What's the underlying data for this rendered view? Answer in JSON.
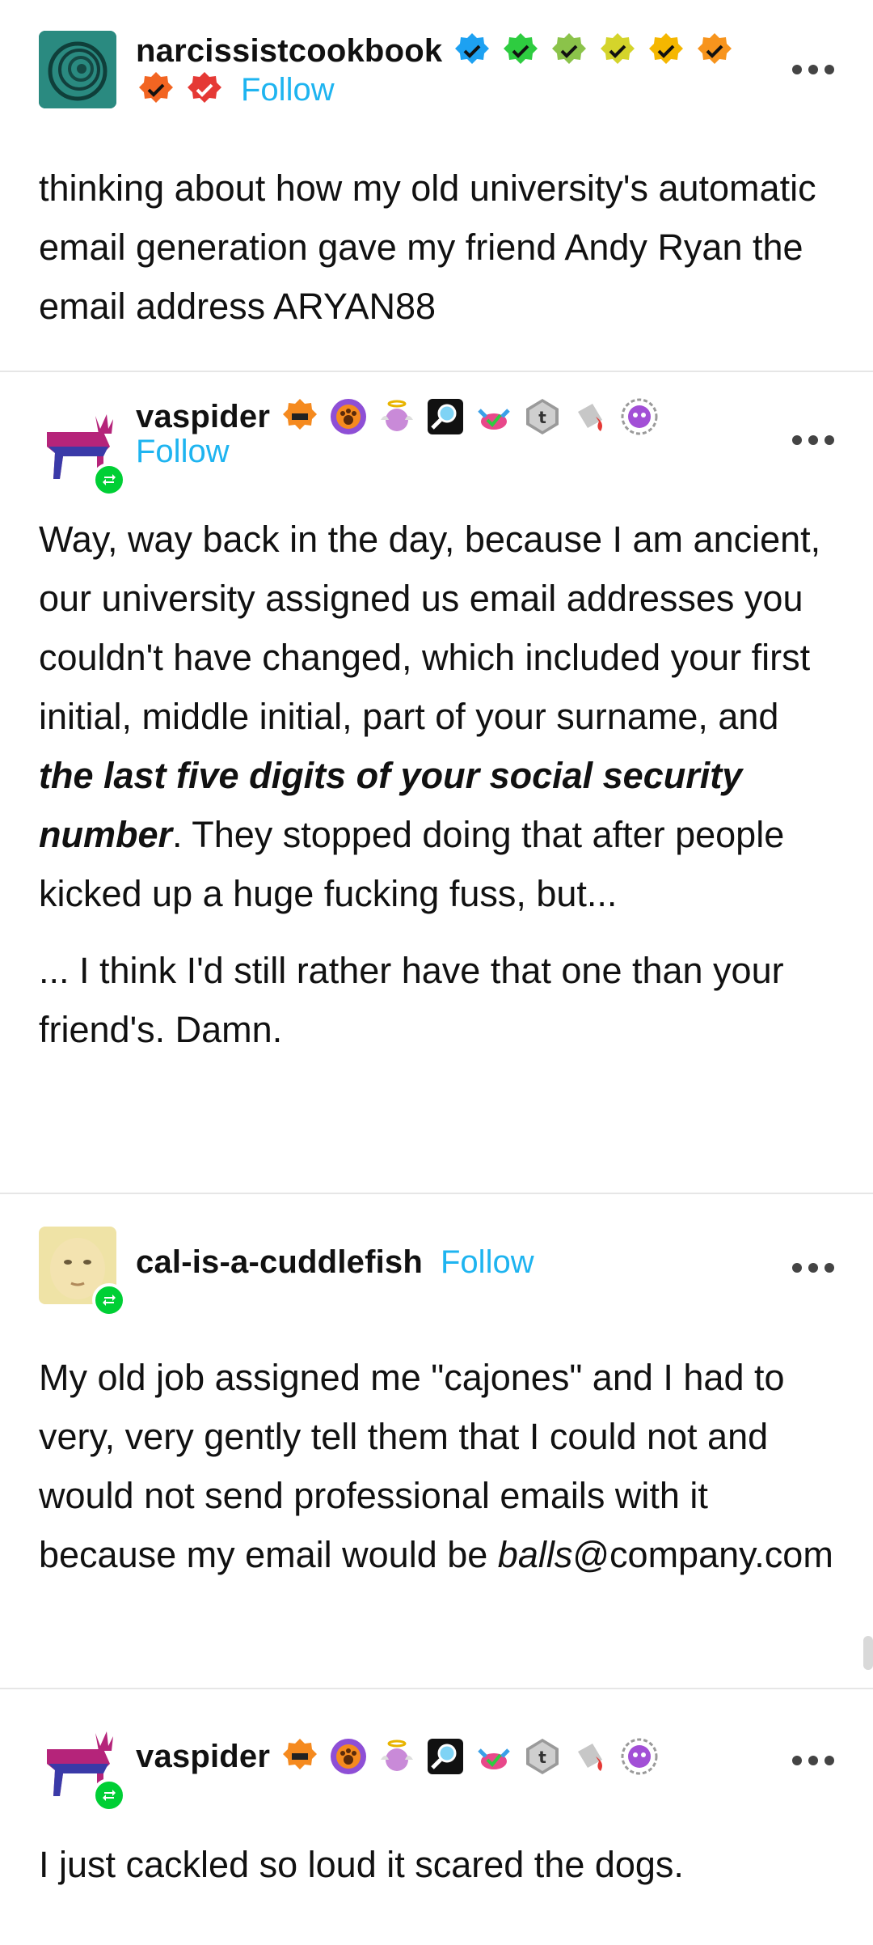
{
  "posts": [
    {
      "username": "narcissistcookbook",
      "follow_label": "Follow",
      "badge_colors": [
        "#1da1f2",
        "#2ecc40",
        "#8bc34a",
        "#d4c62b",
        "#f0b400",
        "#f7941d",
        "#f26522",
        "#e53935"
      ],
      "paragraphs": [
        "thinking about how my old university's automatic email generation gave my friend Andy Ryan the email address ARYAN88"
      ]
    },
    {
      "username": "vaspider",
      "follow_label": "Follow",
      "badge_icons": [
        "chip-icon",
        "paw-icon",
        "angel-icon",
        "magnifier-icon",
        "crab-icon",
        "tumblr-icon",
        "paint-bucket-icon",
        "skull-icon"
      ],
      "paragraphs_parts": {
        "p1_a": "Way, way back in the day, because I am ancient, our university assigned us email addresses you couldn't have changed, which included your first initial, middle initial, part of your surname, and ",
        "p1_em": "the last five digits of your social security number",
        "p1_b": ". They stopped doing that after people kicked up a huge fucking fuss, but...",
        "p2": "... I think I'd still rather have that one than your friend's. Damn."
      }
    },
    {
      "username": "cal-is-a-cuddlefish",
      "follow_label": "Follow",
      "paragraphs_parts": {
        "p1_a": "My old job assigned me \"cajones\" and I had to very, very gently tell them that I could not and would not send professional emails with it because my email would be ",
        "p1_em": "balls",
        "p1_b": "@company.com"
      }
    },
    {
      "username": "vaspider",
      "paragraphs": [
        "I just cackled so loud it scared the dogs."
      ]
    }
  ],
  "accent_color": "#1eb4f0",
  "reblog_badge_color": "#00cf35"
}
